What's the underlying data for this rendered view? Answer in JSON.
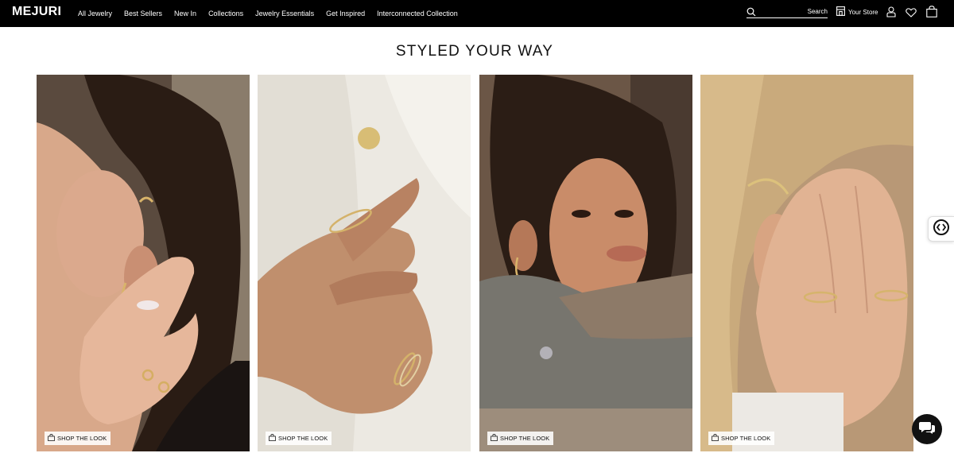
{
  "brand": {
    "logo": "MEJURI"
  },
  "nav": {
    "items": [
      {
        "label": "All Jewelry"
      },
      {
        "label": "Best Sellers"
      },
      {
        "label": "New In"
      },
      {
        "label": "Collections"
      },
      {
        "label": "Jewelry Essentials"
      },
      {
        "label": "Get Inspired"
      },
      {
        "label": "Interconnected Collection"
      }
    ]
  },
  "header": {
    "search_label": "Search",
    "store_label": "Your Store",
    "icons": [
      "search-icon",
      "store-icon",
      "account-icon",
      "wishlist-icon",
      "bag-icon"
    ]
  },
  "section": {
    "title": "STYLED YOUR WAY",
    "cards": [
      {
        "cta": "SHOP THE LOOK",
        "image": "woman-ear-cuffs-and-rings"
      },
      {
        "cta": "SHOP THE LOOK",
        "image": "hand-with-gold-rings-on-white-shirt"
      },
      {
        "cta": "SHOP THE LOOK",
        "image": "woman-portrait-with-ear-cuffs"
      },
      {
        "cta": "SHOP THE LOOK",
        "image": "blonde-woman-ear-and-hand-rings"
      }
    ]
  },
  "widgets": {
    "side": "accessibility-widget-icon",
    "chat": "chat-icon"
  },
  "colors": {
    "topbar": "#000000",
    "background": "#ffffff",
    "text": "#111111",
    "chat": "#111111"
  }
}
